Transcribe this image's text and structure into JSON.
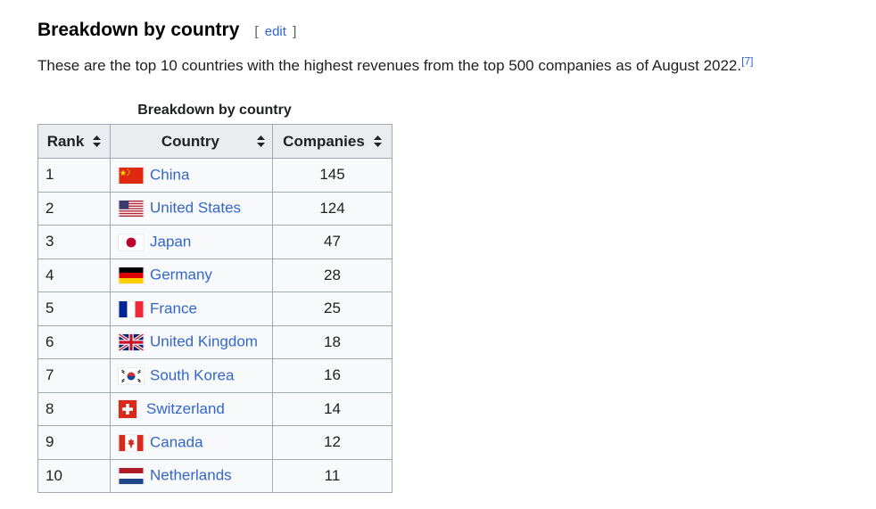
{
  "section": {
    "title": "Breakdown by country",
    "edit_open": "[",
    "edit_label": "edit",
    "edit_close": "]"
  },
  "intro": {
    "text": "These are the top 10 countries with the highest revenues from the top 500 companies as of August 2022.",
    "ref": "[7]"
  },
  "table": {
    "caption": "Breakdown by country",
    "headers": {
      "rank": "Rank",
      "country": "Country",
      "companies": "Companies"
    },
    "rows": [
      {
        "rank": "1",
        "country": "China",
        "flag": "china-flag",
        "companies": "145"
      },
      {
        "rank": "2",
        "country": "United States",
        "flag": "united-states-flag",
        "companies": "124"
      },
      {
        "rank": "3",
        "country": "Japan",
        "flag": "japan-flag",
        "companies": "47"
      },
      {
        "rank": "4",
        "country": "Germany",
        "flag": "germany-flag",
        "companies": "28"
      },
      {
        "rank": "5",
        "country": "France",
        "flag": "france-flag",
        "companies": "25"
      },
      {
        "rank": "6",
        "country": "United Kingdom",
        "flag": "united-kingdom-flag",
        "companies": "18"
      },
      {
        "rank": "7",
        "country": "South Korea",
        "flag": "south-korea-flag",
        "companies": "16"
      },
      {
        "rank": "8",
        "country": "Switzerland",
        "flag": "switzerland-flag",
        "companies": "14"
      },
      {
        "rank": "9",
        "country": "Canada",
        "flag": "canada-flag",
        "companies": "12"
      },
      {
        "rank": "10",
        "country": "Netherlands",
        "flag": "netherlands-flag",
        "companies": "11"
      }
    ]
  },
  "colors": {
    "link": "#3366cc",
    "text": "#202122",
    "header_bg": "#eaecf0",
    "cell_bg": "#f8f9fa",
    "border": "#a2a9b1"
  }
}
